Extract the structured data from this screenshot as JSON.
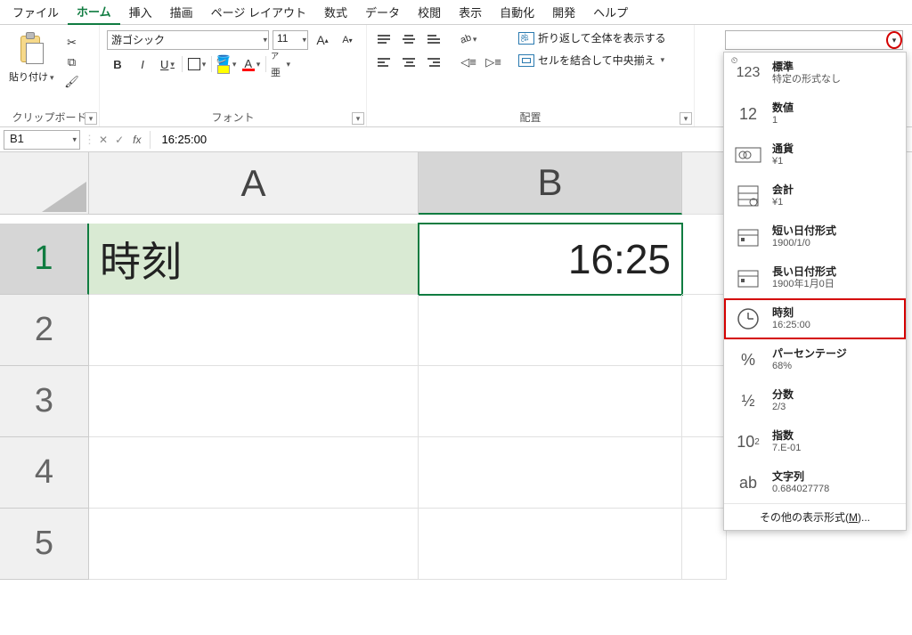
{
  "menus": {
    "file": "ファイル",
    "home": "ホーム",
    "insert": "挿入",
    "draw": "描画",
    "pagelayout": "ページ レイアウト",
    "formulas": "数式",
    "data": "データ",
    "review": "校閲",
    "view": "表示",
    "automate": "自動化",
    "developer": "開発",
    "help": "ヘルプ"
  },
  "ribbon": {
    "clipboard": {
      "paste": "貼り付け",
      "group": "クリップボード"
    },
    "font": {
      "name": "游ゴシック",
      "size": "11",
      "bold": "B",
      "italic": "I",
      "underline": "U",
      "group": "フォント"
    },
    "alignment": {
      "wrap": "折り返して全体を表示する",
      "merge": "セルを結合して中央揃え",
      "group": "配置"
    },
    "number_format": {
      "items": [
        {
          "icon": "123",
          "title": "標準",
          "sample": "特定の形式なし",
          "pre": "⌚"
        },
        {
          "icon": "12",
          "title": "数値",
          "sample": "1"
        },
        {
          "icon": "¥",
          "title": "通貨",
          "sample": "¥1"
        },
        {
          "icon": "acct",
          "title": "会計",
          "sample": "  ¥1"
        },
        {
          "icon": "cal",
          "title": "短い日付形式",
          "sample": "1900/1/0"
        },
        {
          "icon": "cal",
          "title": "長い日付形式",
          "sample": "1900年1月0日"
        },
        {
          "icon": "clock",
          "title": "時刻",
          "sample": "16:25:00",
          "highlight": true
        },
        {
          "icon": "%",
          "title": "パーセンテージ",
          "sample": "68%"
        },
        {
          "icon": "½",
          "title": "分数",
          "sample": " 2/3"
        },
        {
          "icon": "10²",
          "title": "指数",
          "sample": "7.E-01"
        },
        {
          "icon": "ab",
          "title": "文字列",
          "sample": "0.684027778"
        }
      ],
      "footer": "その他の表示形式(",
      "footer_key": "M",
      "footer_tail": ")..."
    }
  },
  "formula_bar": {
    "name_box": "B1",
    "formula": "16:25:00"
  },
  "grid": {
    "col_a": "A",
    "col_b": "B",
    "rows": [
      "1",
      "2",
      "3",
      "4",
      "5"
    ],
    "a1": "時刻",
    "b1": "16:25"
  }
}
